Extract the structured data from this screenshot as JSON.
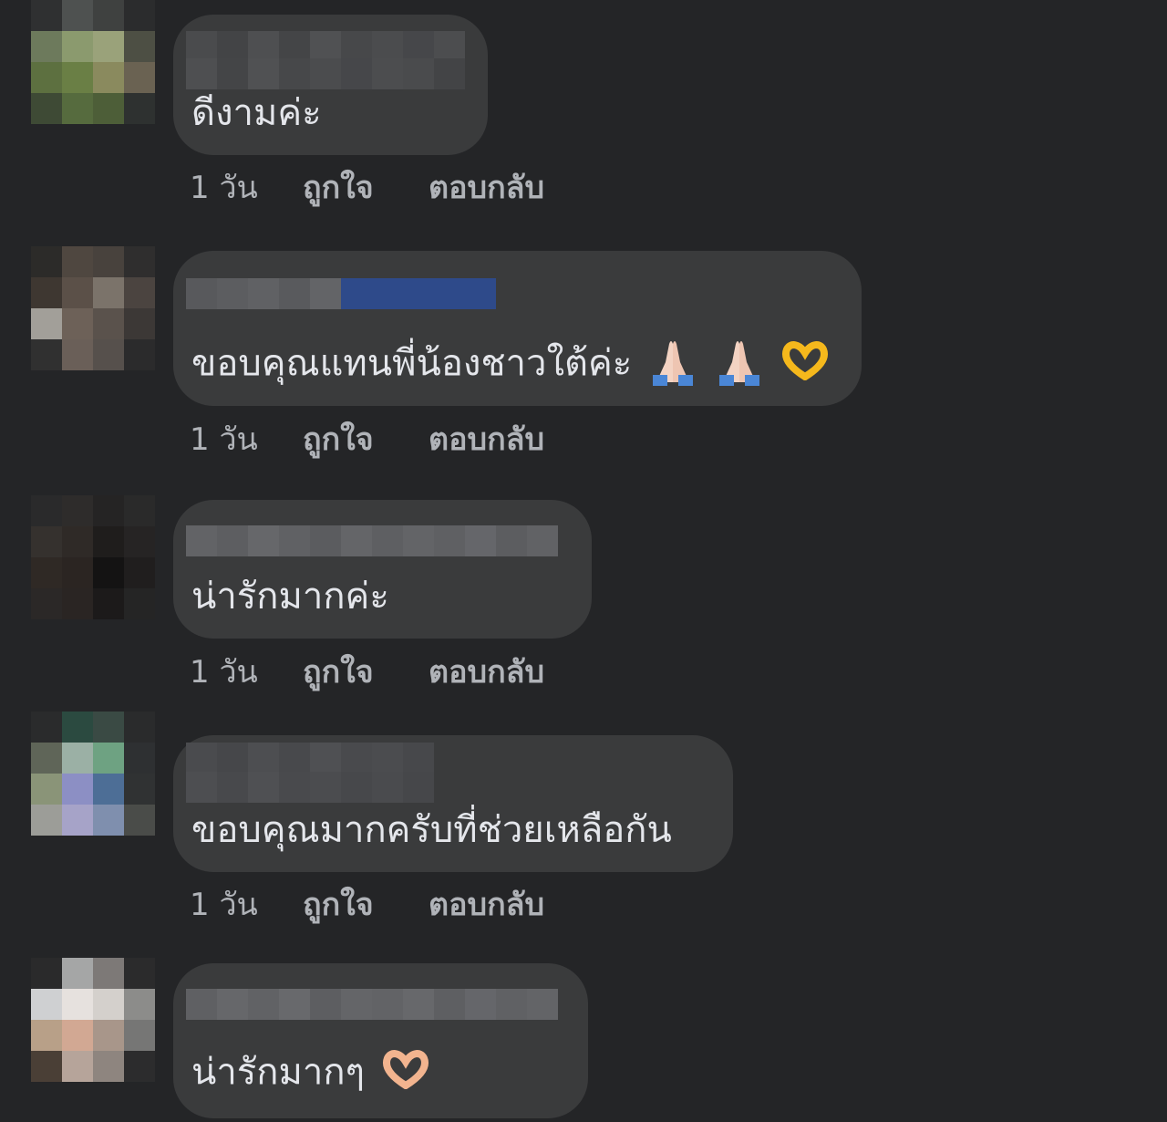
{
  "comments": [
    {
      "text": "ดีงามค่ะ",
      "time": "1 วัน",
      "like": "ถูกใจ",
      "reply": "ตอบกลับ",
      "avatar_colors": [
        "#2f3031",
        "#4e5150",
        "#3f4140",
        "#2b2c2d",
        "#6d7a5c",
        "#8b9a6e",
        "#9aa27a",
        "#4d4f44",
        "#5d7040",
        "#6a7f45",
        "#8a8a5e",
        "#6a6252",
        "#3e4a35",
        "#566b3e",
        "#4d5e38",
        "#2e3130"
      ],
      "name_colors": [
        "#4a4b4d",
        "#434446",
        "#4e4f51",
        "#444547",
        "#505153",
        "#47484a",
        "#4b4c4e",
        "#46474a",
        "#4c4d4f"
      ],
      "emojis": []
    },
    {
      "text": "ขอบคุณแทนพี่น้องชาวใต้ค่ะ",
      "time": "1 วัน",
      "like": "ถูกใจ",
      "reply": "ตอบกลับ",
      "avatar_colors": [
        "#2c2b29",
        "#4f4740",
        "#48423d",
        "#2f2e2e",
        "#3e3731",
        "#5b5048",
        "#7b736a",
        "#4b4440",
        "#a29f99",
        "#6d6158",
        "#5a524c",
        "#3c3836",
        "#303030",
        "#6a5f58",
        "#56504c",
        "#2b2b2c"
      ],
      "name_colors": [
        "#58595c",
        "#5c5d60",
        "#606164",
        "#595a5d",
        "#636467",
        "#2e4a8a",
        "#2e4a8a",
        "#2e4a8a",
        "#2e4a8a",
        "#2e4a8a"
      ],
      "emojis": [
        "folded-hands-icon",
        "folded-hands-icon",
        "heart-hands-icon"
      ]
    },
    {
      "text": "น่ารักมากค่ะ",
      "time": "1 วัน",
      "like": "ถูกใจ",
      "reply": "ตอบกลับ",
      "avatar_colors": [
        "#2a2a2b",
        "#2e2c2b",
        "#252424",
        "#2a2a2a",
        "#35312e",
        "#2f2a27",
        "#1f1d1c",
        "#262424",
        "#2f2925",
        "#2b2522",
        "#141313",
        "#201e1e",
        "#2b2827",
        "#2a2523",
        "#1c1a1a",
        "#252525"
      ],
      "name_colors": [
        "#626366",
        "#5d5e61",
        "#66676a",
        "#606164",
        "#5b5c5f",
        "#646568",
        "#5e5f62",
        "#636467",
        "#5f6063",
        "#65666a",
        "#5c5d60",
        "#616265"
      ],
      "emojis": []
    },
    {
      "text": "ขอบคุณมากครับที่ช่วยเหลือกัน",
      "time": "1 วัน",
      "like": "ถูกใจ",
      "reply": "ตอบกลับ",
      "avatar_colors": [
        "#2a2b2c",
        "#2b4a40",
        "#3a4a44",
        "#2a2b2c",
        "#5f6558",
        "#9bb0a5",
        "#6ea282",
        "#2e3032",
        "#8a9478",
        "#8c8fc4",
        "#4d6e96",
        "#303233",
        "#9c9d98",
        "#a6a3c8",
        "#7f8fae",
        "#4a4c49"
      ],
      "name_colors": [
        "#4a4b4e",
        "#46474a",
        "#4d4e51",
        "#48494c",
        "#4f5053",
        "#494a4d",
        "#4b4c4f",
        "#47484b"
      ],
      "emojis": []
    },
    {
      "text": "น่ารักมากๆ",
      "time": "",
      "like": "",
      "reply": "",
      "avatar_colors": [
        "#2a2a2b",
        "#a5a6a6",
        "#7d7977",
        "#2b2b2c",
        "#cfd0d2",
        "#e6e1de",
        "#d4d0cc",
        "#8c8c8a",
        "#b8a088",
        "#d2a893",
        "#a8968a",
        "#767675",
        "#4a3f36",
        "#b6a49a",
        "#8e857f",
        "#2c2c2d"
      ],
      "name_colors": [
        "#5f6063",
        "#66676a",
        "#616265",
        "#68696c",
        "#5d5e61",
        "#646568",
        "#626366",
        "#67686b",
        "#5e5f62",
        "#65666a",
        "#606164",
        "#636467"
      ],
      "emojis": [
        "heart-hands-icon"
      ]
    }
  ]
}
